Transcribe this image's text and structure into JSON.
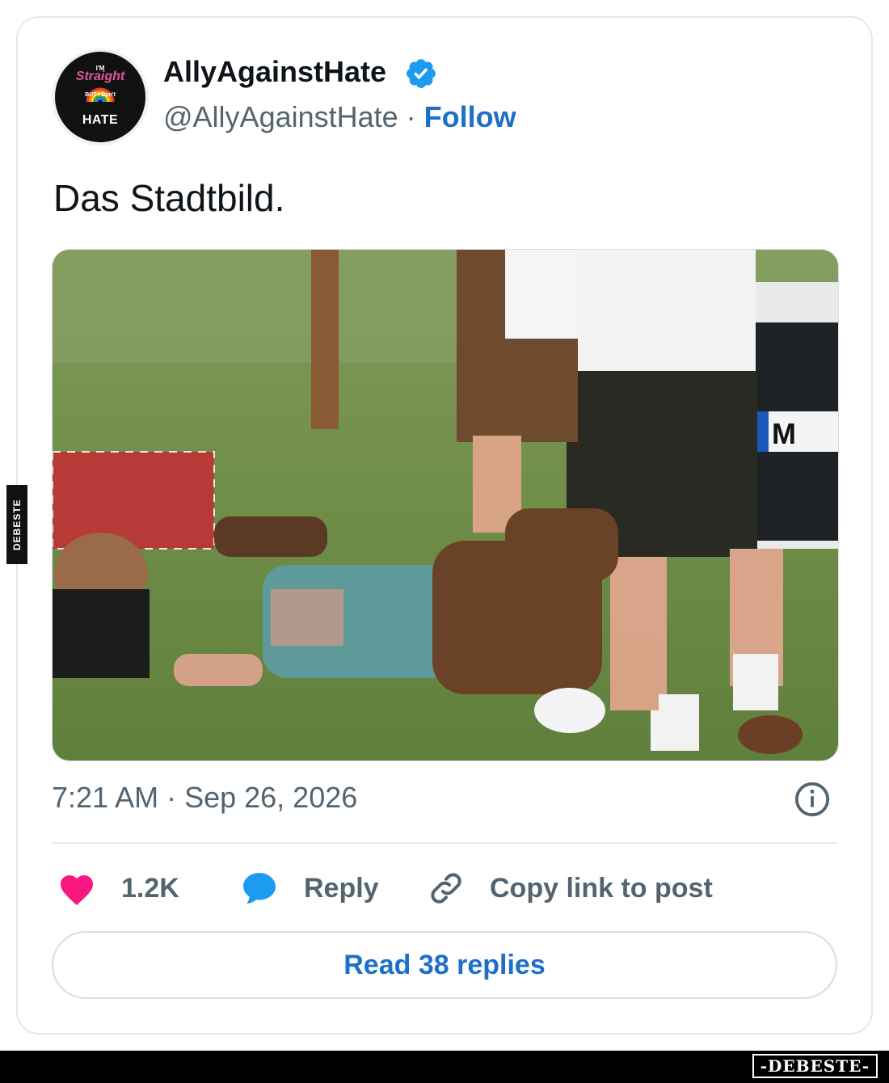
{
  "tweet": {
    "author_name": "AllyAgainstHate",
    "author_handle": "@AllyAgainstHate",
    "separator": " · ",
    "follow_label": "Follow",
    "text": "Das Stadtbild.",
    "timestamp": "7:21 AM · Sep 26, 2026"
  },
  "avatar_text": {
    "line1": "I'M",
    "line2": "Straight",
    "line3": "BUT I Don't",
    "line4": "HATE"
  },
  "photo_text": {
    "plate": "M"
  },
  "actions": {
    "likes_count": "1.2K",
    "reply_label": "Reply",
    "copy_link_label": "Copy link to post"
  },
  "read_replies_label": "Read 38 replies",
  "watermarks": {
    "side": "DEBESTE",
    "footer": "-DEBESTE-"
  },
  "colors": {
    "like": "#f91880",
    "reply": "#1d9bf0",
    "link_blue": "#1d6fc9",
    "muted": "#536471",
    "verified": "#1d9bf0"
  },
  "icons": [
    "verified-badge-icon",
    "info-icon",
    "heart-icon",
    "reply-bubble-icon",
    "link-icon"
  ]
}
